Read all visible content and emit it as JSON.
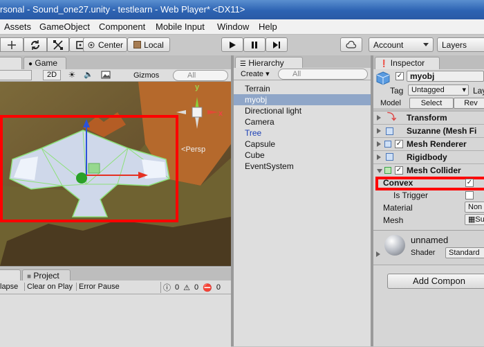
{
  "window": {
    "title": "rsonal - Sound_one27.unity - testlearn - Web Player* <DX11>"
  },
  "menu": [
    "Assets",
    "GameObject",
    "Component",
    "Mobile Input",
    "Window",
    "Help"
  ],
  "toolbar": {
    "pivot_label": "Center",
    "space_label": "Local",
    "account_label": "Account",
    "layers_label": "Layers"
  },
  "scene": {
    "game_tab": "Game",
    "mode_2d": "2D",
    "gizmos_label": "Gizmos",
    "search_placeholder": "All",
    "persp_label": "Persp",
    "axis_y": "y",
    "axis_x": "x"
  },
  "hierarchy": {
    "tab": "Hierarchy",
    "create_label": "Create",
    "search_placeholder": "All",
    "items": [
      "Terrain",
      "myobj",
      "Directional light",
      "Camera",
      "Tree",
      "Capsule",
      "Cube",
      "EventSystem"
    ]
  },
  "console": {
    "project_tab": "Project",
    "collapse": "lapse",
    "clear_on_play": "Clear on Play",
    "error_pause": "Error Pause",
    "info_count": "0",
    "warn_count": "0",
    "error_count": "0"
  },
  "inspector": {
    "tab": "Inspector",
    "object_name": "myobj",
    "tag_label": "Tag",
    "tag_value": "Untagged",
    "layer_label": "Lay",
    "model_label": "Model",
    "select_label": "Select",
    "revert_label": "Rev",
    "components": [
      "Transform",
      "Suzanne (Mesh Fi",
      "Mesh Renderer",
      "Rigidbody",
      "Mesh Collider"
    ],
    "convex_label": "Convex",
    "convex_checked": "✓",
    "is_trigger_label": "Is Trigger",
    "material_label": "Material",
    "material_value": "Non",
    "mesh_label": "Mesh",
    "mesh_value": "Su",
    "material_name": "unnamed",
    "shader_label": "Shader",
    "shader_value": "Standard",
    "add_component": "Add Compon"
  },
  "colors": {
    "highlight_red": "#ff0000",
    "selection_blue": "#3d7edb"
  }
}
